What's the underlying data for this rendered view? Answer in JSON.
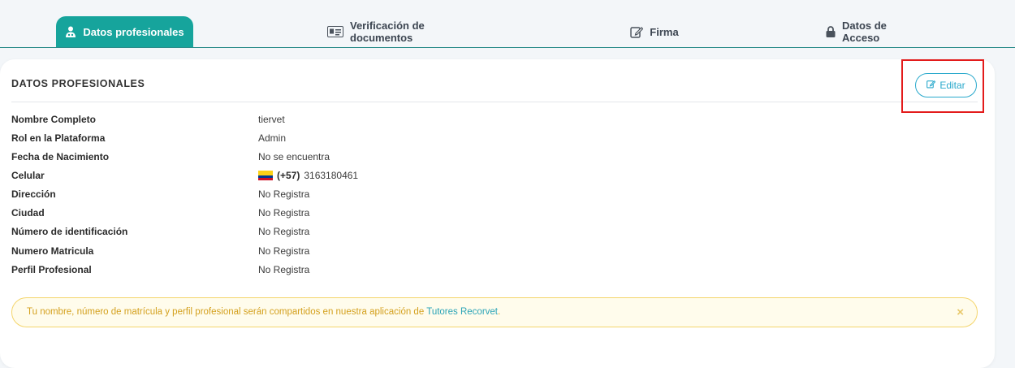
{
  "tabs": [
    {
      "label": "Datos profesionales",
      "icon": "user-doctor-icon",
      "active": true
    },
    {
      "label": "Verificación de documentos",
      "icon": "id-card-icon",
      "active": false
    },
    {
      "label": "Firma",
      "icon": "edit-icon",
      "active": false
    },
    {
      "label": "Datos de Acceso",
      "icon": "lock-icon",
      "active": false
    }
  ],
  "card": {
    "title": "DATOS PROFESIONALES",
    "edit_label": "Editar"
  },
  "fields": [
    {
      "label": "Nombre Completo",
      "value": "tiervet"
    },
    {
      "label": "Rol en la Plataforma",
      "value": "Admin"
    },
    {
      "label": "Fecha de Nacimiento",
      "value": "No se encuentra"
    },
    {
      "label": "Celular",
      "country_code": "(+57)",
      "value": "3163180461",
      "flag": "colombia-flag-icon"
    },
    {
      "label": "Dirección",
      "value": "No Registra"
    },
    {
      "label": "Ciudad",
      "value": "No Registra"
    },
    {
      "label": "Número de identificación",
      "value": "No Registra"
    },
    {
      "label": "Numero Matricula",
      "value": "No Registra"
    },
    {
      "label": "Perfil Profesional",
      "value": "No Registra"
    }
  ],
  "alert": {
    "text": "Tu nombre, número de matrícula y perfil profesional serán compartidos en nuestra aplicación de ",
    "link": "Tutores Recorvet",
    "suffix": ".",
    "close": "×"
  },
  "colors": {
    "accent": "#16a49c",
    "edit": "#29a9cc",
    "highlight": "#e31b1b",
    "alert_text": "#d4a01d"
  }
}
